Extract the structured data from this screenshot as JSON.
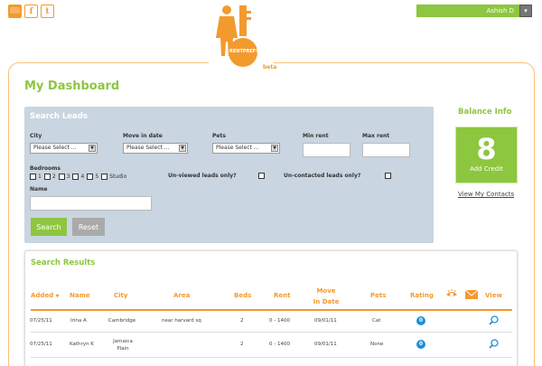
{
  "header": {
    "user_name": "Ashish D",
    "dropdown_arrow": "▾",
    "logo_text": "RENTPREFS",
    "logo_tag": "beta",
    "social": {
      "facebook": "f",
      "twitter": "t"
    }
  },
  "page": {
    "title": "My Dashboard"
  },
  "search": {
    "title": "Search Leads",
    "city_label": "City",
    "city_value": "Please Select ...",
    "move_in_label": "Move in date",
    "move_in_value": "Please Select ...",
    "pets_label": "Pets",
    "pets_value": "Please Select ...",
    "min_rent_label": "Min rent",
    "max_rent_label": "Max rent",
    "bedrooms_label": "Bedrooms",
    "bedroom_options": [
      "1",
      "2",
      "3",
      "4",
      "5",
      "Studio"
    ],
    "unviewed_label": "Un-viewed leads only?",
    "uncontacted_label": "Un-contacted leads only?",
    "name_label": "Name",
    "search_button": "Search",
    "reset_button": "Reset"
  },
  "balance": {
    "title": "Balance Info",
    "credits": "8",
    "add_credit": "Add Credit",
    "view_contacts": "View My Contacts"
  },
  "results": {
    "title": "Search Results",
    "columns": {
      "added": "Added",
      "sort_icon": "▼",
      "name": "Name",
      "city": "City",
      "area": "Area",
      "beds": "Beds",
      "rent": "Rent",
      "move_in": "Move In Date",
      "pets": "Pets",
      "rating": "Rating",
      "view": "View"
    },
    "rows": [
      {
        "added": "07/25/11",
        "name": "Irina A",
        "city": "Cambridge",
        "area": "near harvard sq",
        "beds": "2",
        "rent": "0 - 1400",
        "move_in": "09/01/11",
        "pets": "Cat",
        "rating": "0"
      },
      {
        "added": "07/25/11",
        "name": "Kathryn K",
        "city": "Jamaica Plain",
        "area": "",
        "beds": "2",
        "rent": "0 - 1400",
        "move_in": "09/01/11",
        "pets": "None",
        "rating": "0"
      }
    ]
  },
  "colors": {
    "accent_green": "#8dc63f",
    "accent_orange": "#f39a2e",
    "rating_blue": "#1e8fd6",
    "panel_blue": "#c9d5e0"
  }
}
